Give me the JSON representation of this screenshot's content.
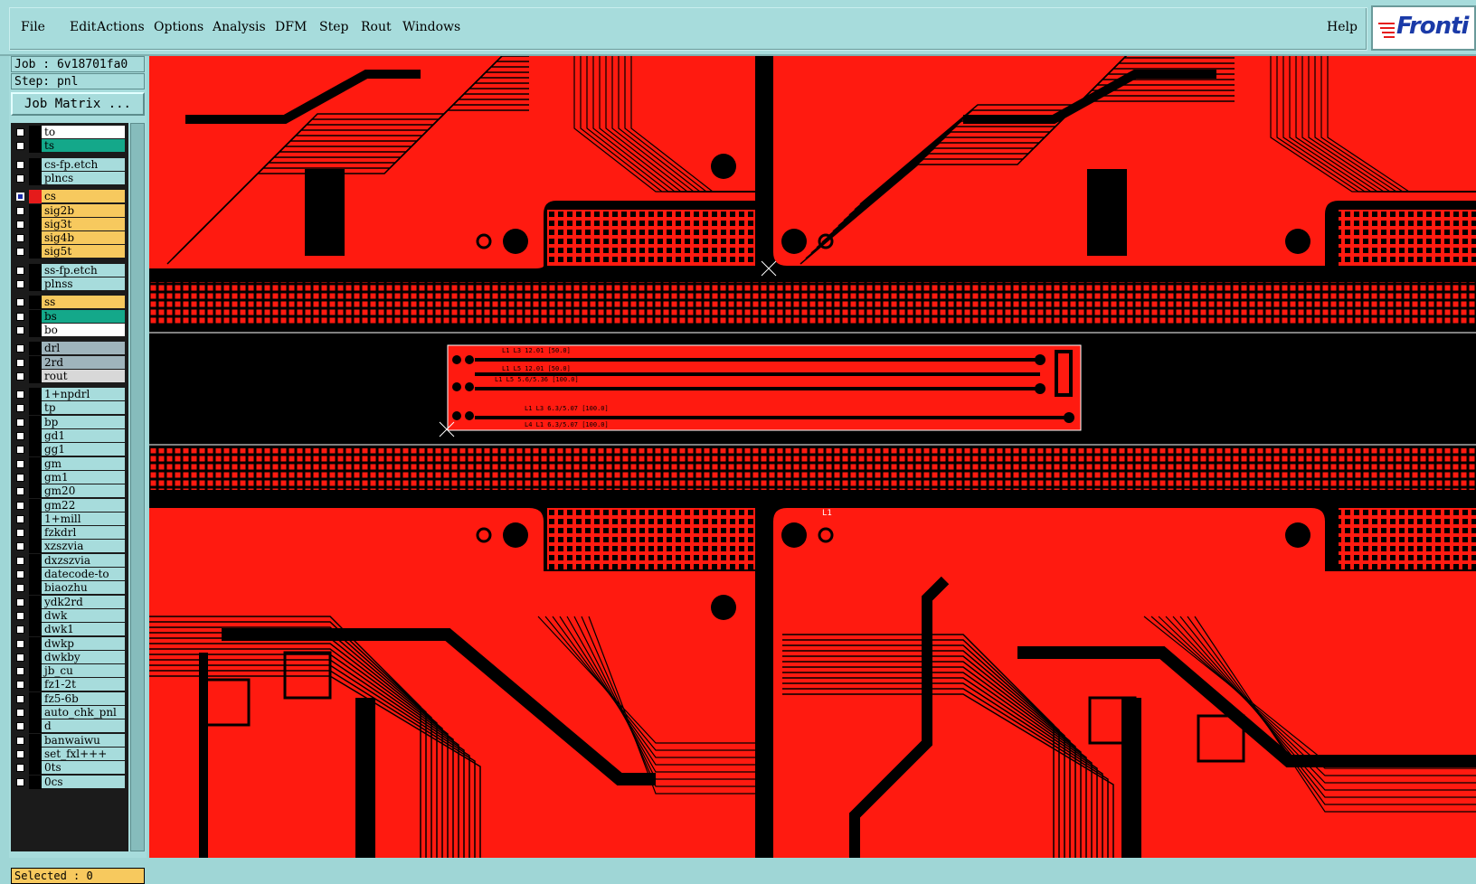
{
  "menubar": {
    "items": [
      "File",
      "Edit",
      "Actions",
      "Options",
      "Analysis",
      "DFM",
      "Step",
      "Rout",
      "Windows"
    ],
    "help": "Help"
  },
  "logo": {
    "text": "Fronti"
  },
  "panel": {
    "job_label": "Job : 6v18701fa0",
    "step_label": "Step: pnl",
    "job_matrix": "Job Matrix ...",
    "selected": "Selected : 0"
  },
  "layers": [
    {
      "name": "to",
      "color": "#ffffff",
      "group": 0
    },
    {
      "name": "ts",
      "color": "#14a88a",
      "group": 0
    },
    {
      "name": "cs-fp.etch",
      "color": "#a7dcdc",
      "group": 1
    },
    {
      "name": "plncs",
      "color": "#a7dcdc",
      "group": 1
    },
    {
      "name": "cs",
      "color": "#f7c95e",
      "group": 2,
      "active": true
    },
    {
      "name": "sig2b",
      "color": "#f7c95e",
      "group": 2
    },
    {
      "name": "sig3t",
      "color": "#f7c95e",
      "group": 2
    },
    {
      "name": "sig4b",
      "color": "#f7c95e",
      "group": 2
    },
    {
      "name": "sig5t",
      "color": "#f7c95e",
      "group": 2
    },
    {
      "name": "ss-fp.etch",
      "color": "#a7dcdc",
      "group": 3
    },
    {
      "name": "plnss",
      "color": "#a7dcdc",
      "group": 3
    },
    {
      "name": "ss",
      "color": "#f7c95e",
      "group": 4
    },
    {
      "name": "bs",
      "color": "#14a88a",
      "group": 4
    },
    {
      "name": "bo",
      "color": "#ffffff",
      "group": 4
    },
    {
      "name": "drl",
      "color": "#9fb4bc",
      "group": 5
    },
    {
      "name": "2rd",
      "color": "#9fb4bc",
      "group": 5
    },
    {
      "name": "rout",
      "color": "#d8d8d8",
      "group": 5
    },
    {
      "name": "1+npdrl",
      "color": "#a7dcdc",
      "group": 6
    },
    {
      "name": "tp",
      "color": "#a7dcdc",
      "group": 6
    },
    {
      "name": "bp",
      "color": "#a7dcdc",
      "group": 6
    },
    {
      "name": "gd1",
      "color": "#a7dcdc",
      "group": 6
    },
    {
      "name": "gg1",
      "color": "#a7dcdc",
      "group": 6
    },
    {
      "name": "gm",
      "color": "#a7dcdc",
      "group": 6
    },
    {
      "name": "gm1",
      "color": "#a7dcdc",
      "group": 6
    },
    {
      "name": "gm20",
      "color": "#a7dcdc",
      "group": 6
    },
    {
      "name": "gm22",
      "color": "#a7dcdc",
      "group": 6
    },
    {
      "name": "1+mill",
      "color": "#a7dcdc",
      "group": 6
    },
    {
      "name": "fzkdrl",
      "color": "#a7dcdc",
      "group": 6
    },
    {
      "name": "xzszvia",
      "color": "#a7dcdc",
      "group": 6
    },
    {
      "name": "dxzszvia",
      "color": "#a7dcdc",
      "group": 6
    },
    {
      "name": "datecode-to",
      "color": "#a7dcdc",
      "group": 6
    },
    {
      "name": "biaozhu",
      "color": "#a7dcdc",
      "group": 6
    },
    {
      "name": "ydk2rd",
      "color": "#a7dcdc",
      "group": 6
    },
    {
      "name": "dwk",
      "color": "#a7dcdc",
      "group": 6
    },
    {
      "name": "dwk1",
      "color": "#a7dcdc",
      "group": 6
    },
    {
      "name": "dwkp",
      "color": "#a7dcdc",
      "group": 6
    },
    {
      "name": "dwkby",
      "color": "#a7dcdc",
      "group": 6
    },
    {
      "name": "jb_cu",
      "color": "#a7dcdc",
      "group": 6
    },
    {
      "name": "fz1-2t",
      "color": "#a7dcdc",
      "group": 6
    },
    {
      "name": "fz5-6b",
      "color": "#a7dcdc",
      "group": 6
    },
    {
      "name": "auto_chk_pnl",
      "color": "#a7dcdc",
      "group": 6
    },
    {
      "name": "d",
      "color": "#a7dcdc",
      "group": 6
    },
    {
      "name": "banwaiwu",
      "color": "#a7dcdc",
      "group": 6
    },
    {
      "name": "set_fxl+++",
      "color": "#a7dcdc",
      "group": 6
    },
    {
      "name": "0ts",
      "color": "#a7dcdc",
      "group": 6
    },
    {
      "name": "0cs",
      "color": "#a7dcdc",
      "group": 6
    }
  ],
  "canvas": {
    "copper_color": "#ff1a10",
    "coupon_labels": [
      "L1 L3 12.01 [50.0]",
      "L1 L5 12.01 [50.0]",
      "L1 L5 5.6/5.36 [100.0]",
      "L1 L3 6.3/5.07 [100.0]",
      "L4 L1 6.3/5.07 [100.0]"
    ],
    "marker_label": "L1"
  },
  "colors": {
    "panel_bg": "#a7dcdc",
    "active_layer": "#e51b1b"
  }
}
